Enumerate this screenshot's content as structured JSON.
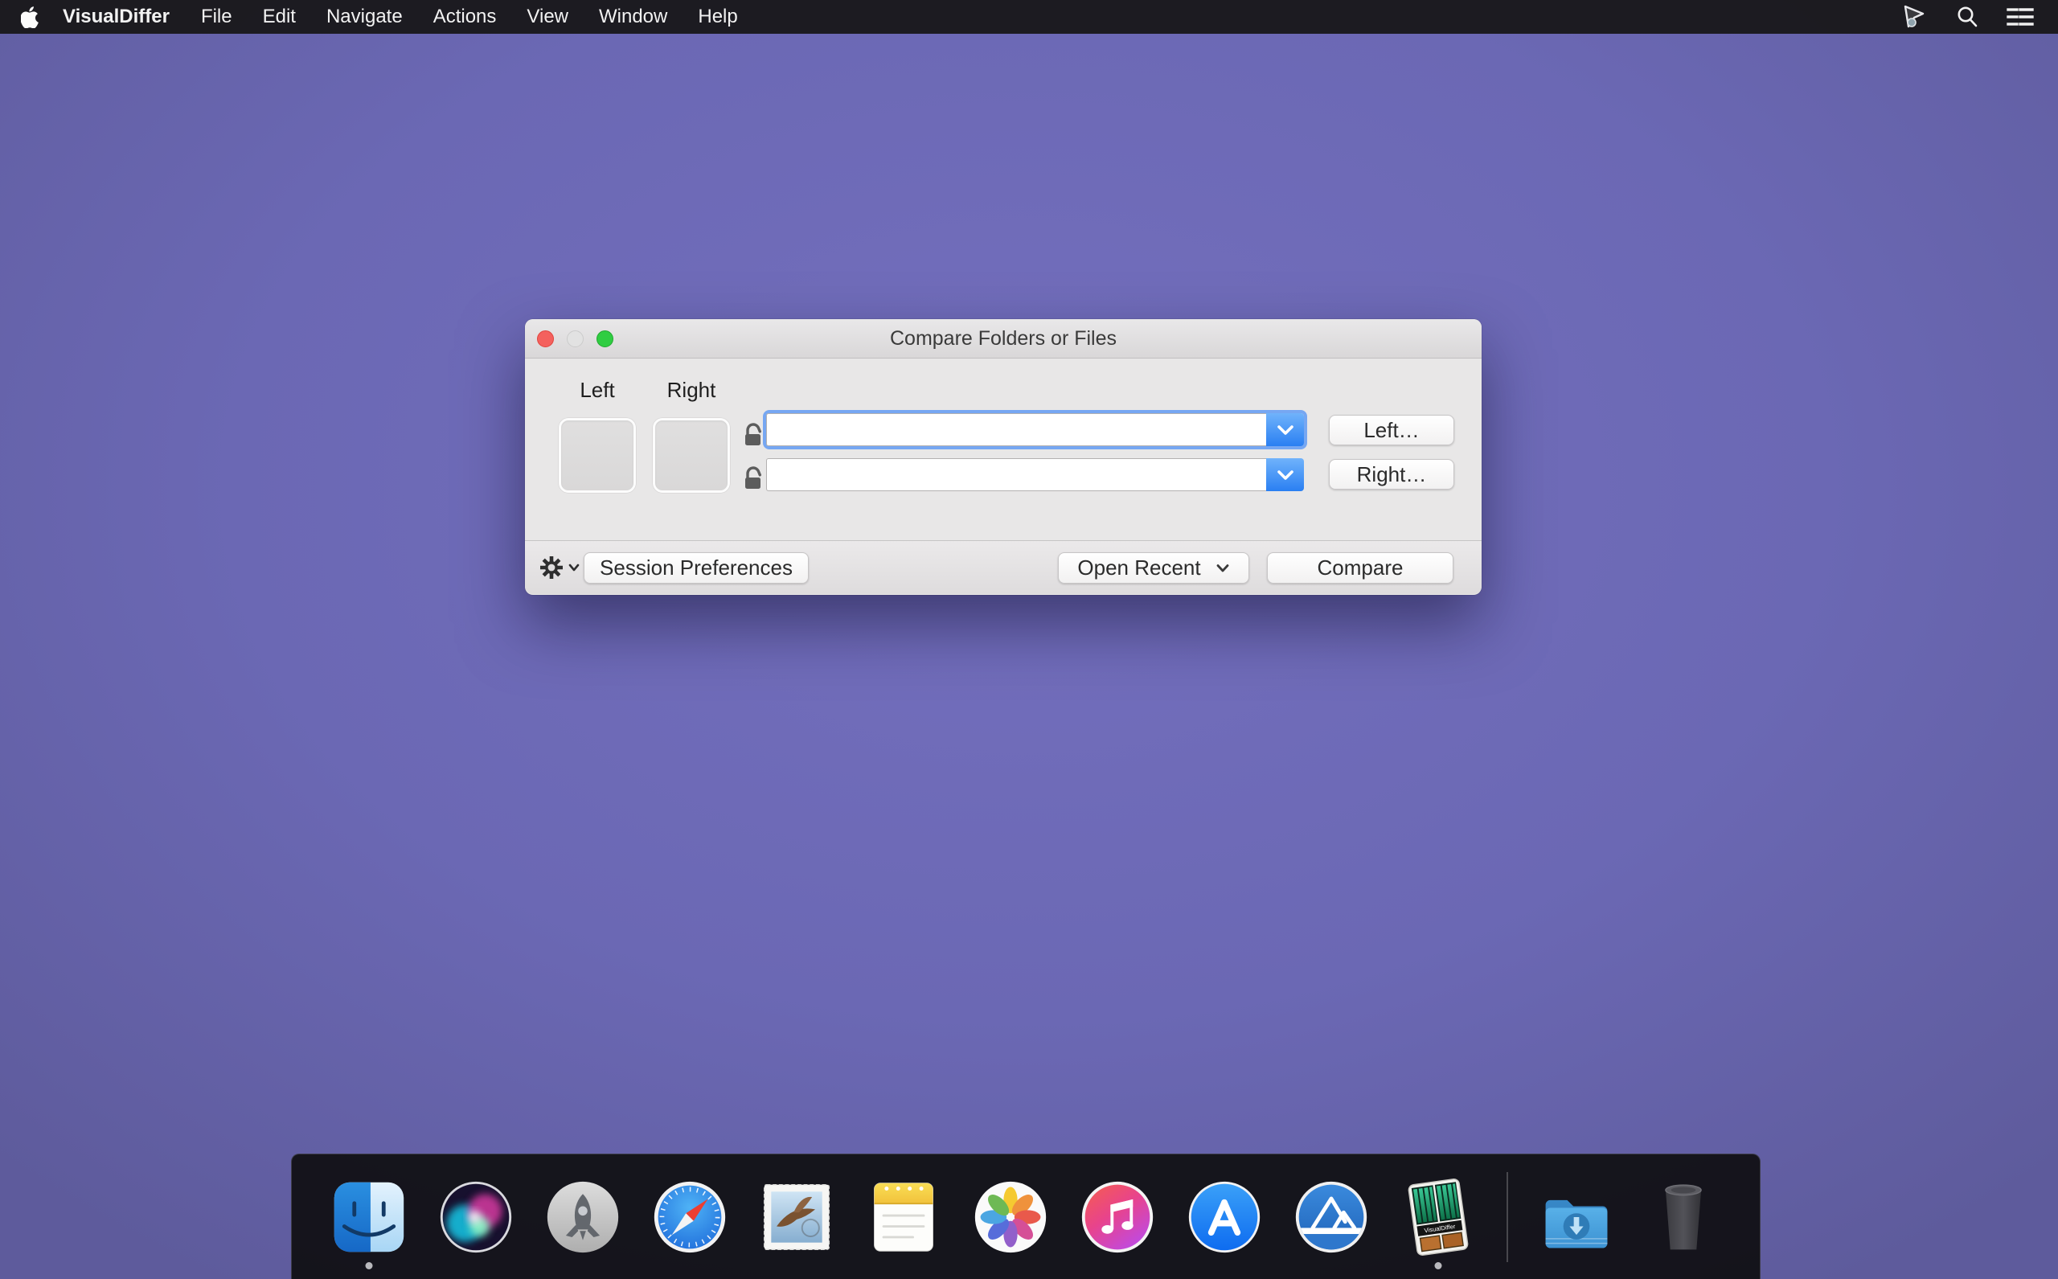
{
  "menu_bar": {
    "app_name": "VisualDiffer",
    "menus": [
      "File",
      "Edit",
      "Navigate",
      "Actions",
      "View",
      "Window",
      "Help"
    ],
    "status_icons": [
      "cursor-status-icon",
      "spotlight-search-icon",
      "notification-center-icon"
    ]
  },
  "window": {
    "title": "Compare Folders or Files",
    "left_label": "Left",
    "right_label": "Right",
    "left_path_value": "",
    "right_path_value": "",
    "left_button": "Left…",
    "right_button": "Right…",
    "session_preferences_button": "Session Preferences",
    "open_recent_button": "Open Recent",
    "compare_button": "Compare"
  },
  "dock": {
    "visualdiffer_label": "VisualDiffer",
    "items": [
      "finder",
      "siri",
      "launchpad",
      "safari",
      "mail",
      "notes",
      "photos",
      "itunes",
      "app-store",
      "mountain-app",
      "visualdiffer",
      "separator",
      "downloads-folder",
      "trash"
    ],
    "running_apps": [
      "finder",
      "visualdiffer"
    ]
  },
  "colors": {
    "desktop": "#6b68b4",
    "menu_bar": "#1a191c",
    "focus_ring": "#5091f5",
    "combo_button_blue": "#2a7ff2",
    "traffic_close": "#f4615e",
    "traffic_minimize_disabled": "#e2e2e2",
    "traffic_zoom": "#30cd42"
  }
}
